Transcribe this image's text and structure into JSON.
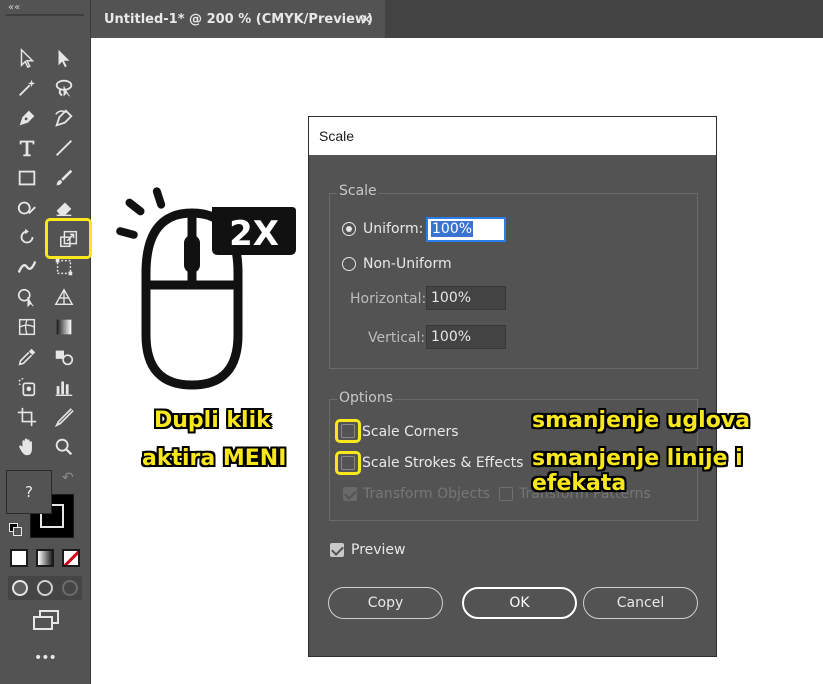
{
  "document_tab": {
    "title": "Untitled-1* @ 200 % (CMYK/Preview)",
    "close": "✕"
  },
  "toolbar": {
    "collapse": "««",
    "unknown_color": "?",
    "more": "•••"
  },
  "annotations": {
    "double_click_badge": "2X",
    "left_line1": "Dupli klik",
    "left_line2": "aktira MENI",
    "right_line1": "smanjenje uglova",
    "right_line2": "smanjenje linije i efekata",
    "highlight_color": "#f8e71c"
  },
  "dialog": {
    "title": "Scale",
    "scale_group": {
      "legend": "Scale",
      "uniform_label": "Uniform:",
      "uniform_value": "100%",
      "non_uniform_label": "Non-Uniform",
      "horizontal_label": "Horizontal:",
      "horizontal_value": "100%",
      "vertical_label": "Vertical:",
      "vertical_value": "100%",
      "selected": "Uniform"
    },
    "options_group": {
      "legend": "Options",
      "scale_corners": "Scale Corners",
      "scale_strokes": "Scale Strokes & Effects",
      "transform_objects": "Transform Objects",
      "transform_patterns": "Transform Patterns"
    },
    "preview_label": "Preview",
    "buttons": {
      "copy": "Copy",
      "ok": "OK",
      "cancel": "Cancel"
    }
  }
}
